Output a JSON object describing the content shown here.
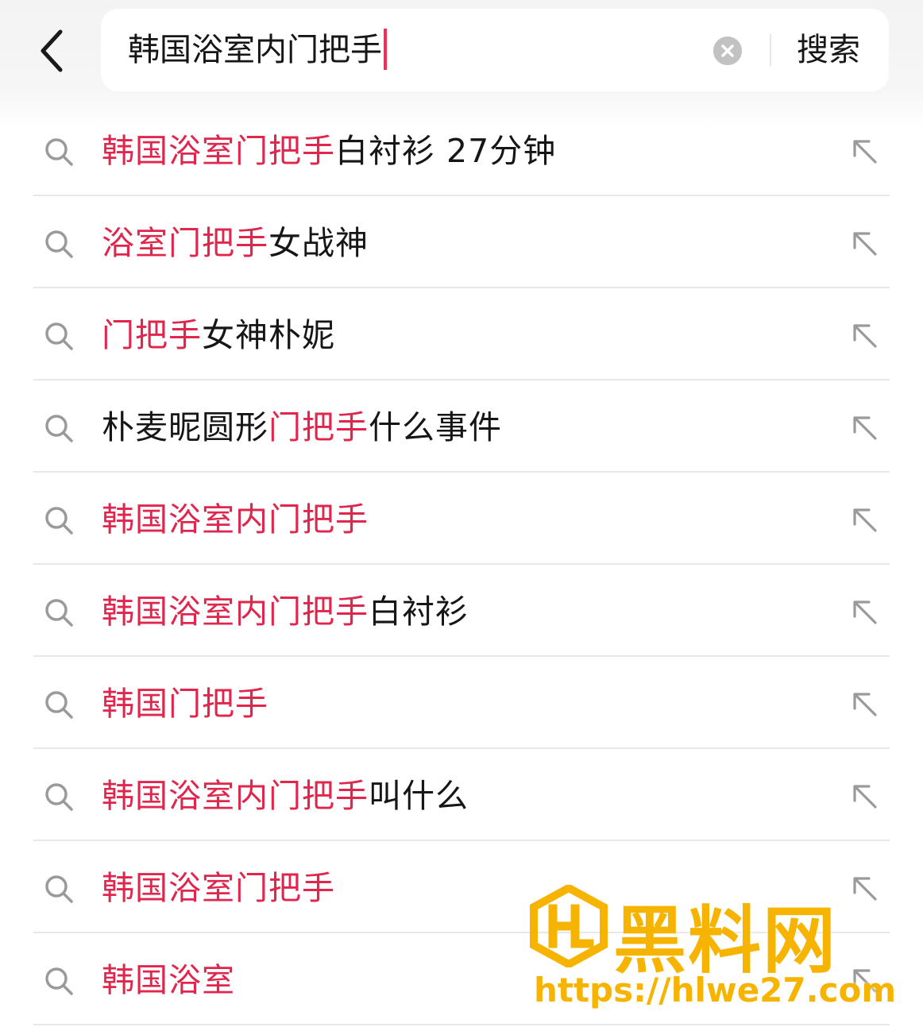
{
  "colors": {
    "accent": "#e0264d",
    "caret": "#fe2c55",
    "text": "#161616",
    "icon_gray": "#9a9a9a",
    "watermark": "#f6b400"
  },
  "header": {
    "back_icon": "chevron-left-icon",
    "search": {
      "value": "韩国浴室内门把手",
      "clear_icon": "clear-circle-icon",
      "button_label": "搜索"
    }
  },
  "suggestions": [
    {
      "highlight": "韩国浴室门把手",
      "rest": "白衬衫 27分钟"
    },
    {
      "highlight": "浴室门把手",
      "rest": "女战神"
    },
    {
      "highlight": "门把手",
      "rest": "女神朴妮"
    },
    {
      "prefix": "朴麦昵圆形",
      "highlight": "门把手",
      "rest": "什么事件"
    },
    {
      "highlight": "韩国浴室内门把手",
      "rest": ""
    },
    {
      "highlight": "韩国浴室内门把手",
      "rest": "白衬衫"
    },
    {
      "highlight": "韩国门把手",
      "rest": ""
    },
    {
      "highlight": "韩国浴室内门把手",
      "rest": "叫什么"
    },
    {
      "highlight": "韩国浴室门把手",
      "rest": ""
    },
    {
      "highlight": "韩国浴室",
      "rest": ""
    }
  ],
  "suggestion_icons": {
    "left": "search-icon",
    "right": "arrow-up-left-icon"
  },
  "watermark": {
    "title": "黑料网",
    "url": "https://hlwe27.com"
  }
}
